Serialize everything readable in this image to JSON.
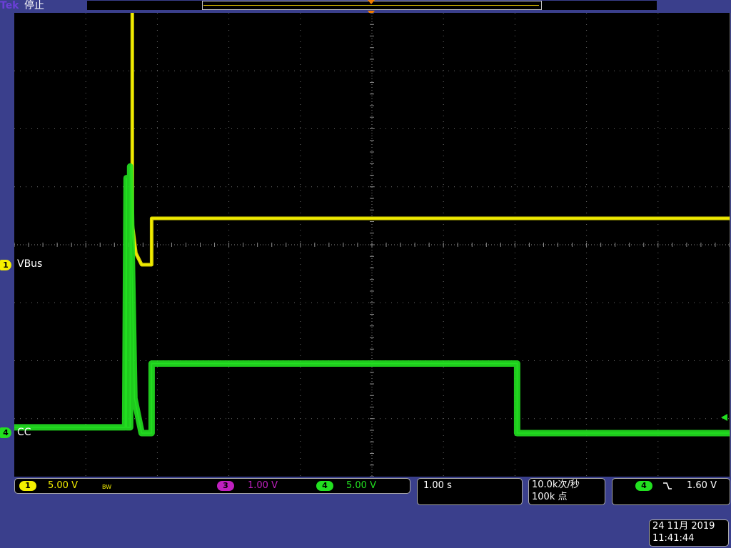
{
  "header": {
    "brand": "Tek",
    "acquisition_state": "停止"
  },
  "colors": {
    "ch1": "#f5f000",
    "ch3": "#c020c0",
    "ch4": "#22e020",
    "trigger": "#f07b00",
    "frame": "#3a3f8c"
  },
  "traces": {
    "ch1_label": "VBus",
    "ch4_label": "CC"
  },
  "channels": {
    "ch1": {
      "number": "1",
      "scale": "5.00 V",
      "bw_flag": "BW"
    },
    "ch3": {
      "number": "3",
      "scale": "1.00 V"
    },
    "ch4": {
      "number": "4",
      "scale": "5.00 V"
    }
  },
  "timebase": {
    "scale": "1.00 s"
  },
  "acquisition": {
    "sample_rate": "10.0k次/秒",
    "record_length": "100k 点"
  },
  "trigger": {
    "source": "4",
    "slope_icon": "falling-edge-icon",
    "level": "1.60 V"
  },
  "datetime": {
    "date": "24 11月 2019",
    "time": "11:41:44"
  },
  "chart_data": {
    "type": "line",
    "x_unit": "s",
    "x_divisions": 10,
    "y_divisions": 8,
    "grid": true,
    "series": [
      {
        "name": "VBus",
        "x": [
          -5,
          -3.35,
          -3.35,
          -3.3,
          -3.22,
          -3.08,
          -3.08,
          5
        ],
        "y": [
          5.2,
          5.2,
          0.7,
          0.2,
          0.0,
          0.0,
          0.8,
          0.8
        ]
      },
      {
        "name": "CC",
        "x": [
          -5,
          -3.45,
          -3.43,
          -3.43,
          -3.38,
          -3.38,
          -3.32,
          -3.22,
          -3.08,
          -3.08,
          2.03,
          2.03,
          5
        ],
        "y": [
          0.1,
          0.1,
          4.4,
          0.1,
          0.1,
          4.6,
          0.6,
          0.0,
          0.0,
          1.2,
          1.2,
          0.0,
          0.0
        ]
      }
    ]
  }
}
